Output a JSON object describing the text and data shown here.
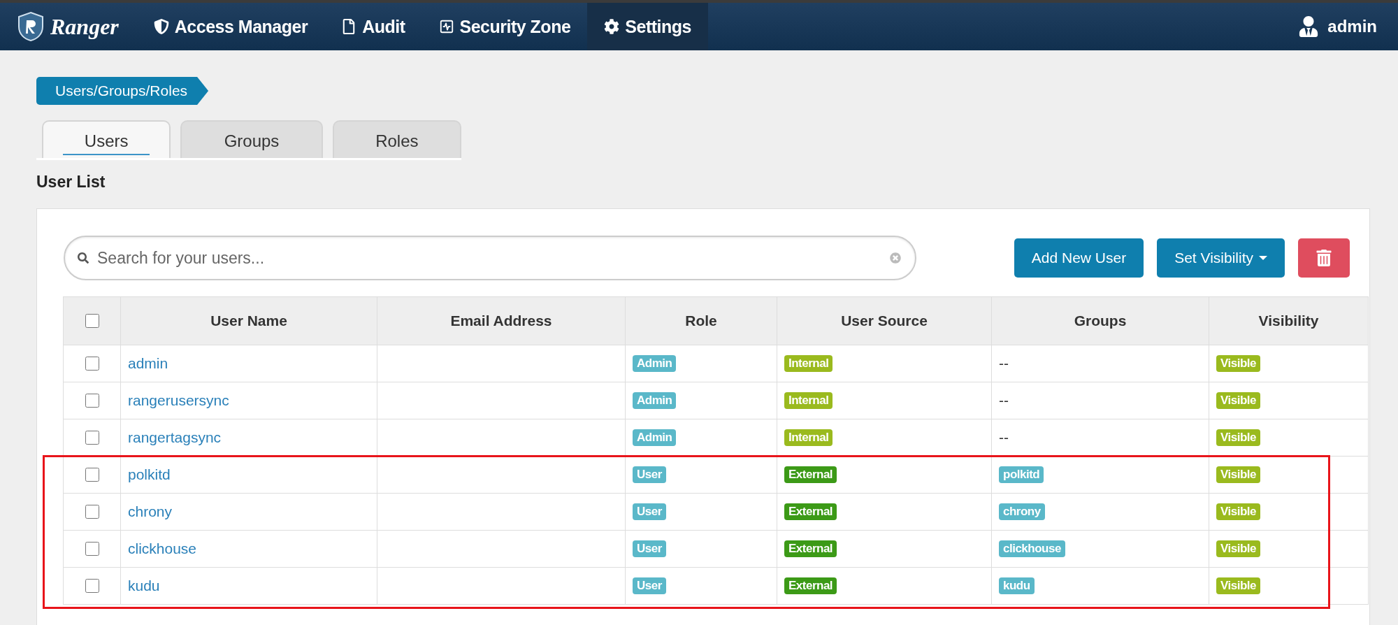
{
  "navbar": {
    "brand": "Ranger",
    "items": [
      {
        "label": "Access Manager",
        "selected": false
      },
      {
        "label": "Audit",
        "selected": false
      },
      {
        "label": "Security Zone",
        "selected": false
      },
      {
        "label": "Settings",
        "selected": true
      }
    ],
    "user": "admin"
  },
  "breadcrumb": "Users/Groups/Roles",
  "tabs": [
    {
      "label": "Users",
      "selected": true
    },
    {
      "label": "Groups",
      "selected": false
    },
    {
      "label": "Roles",
      "selected": false
    }
  ],
  "section_title": "User List",
  "search": {
    "placeholder": "Search for your users..."
  },
  "buttons": [
    {
      "kind": "primary",
      "label": "Add New User"
    },
    {
      "kind": "dropdown",
      "label": "Set Visibility"
    },
    {
      "kind": "delete"
    }
  ],
  "table": {
    "header_checked": false,
    "columns": [
      "User Name",
      "Email Address",
      "Role",
      "User Source",
      "Groups",
      "Visibility"
    ],
    "rows": [
      {
        "name": "admin",
        "role": "Admin",
        "source": {
          "kind": "internal",
          "text": "Internal"
        },
        "groups": {
          "kind": "none",
          "text": "--"
        },
        "visibility": "Visible",
        "checked": false,
        "highlighted": false
      },
      {
        "name": "rangerusersync",
        "role": "Admin",
        "source": {
          "kind": "internal",
          "text": "Internal"
        },
        "groups": {
          "kind": "none",
          "text": "--"
        },
        "visibility": "Visible",
        "checked": false,
        "highlighted": false
      },
      {
        "name": "rangertagsync",
        "role": "Admin",
        "source": {
          "kind": "internal",
          "text": "Internal"
        },
        "groups": {
          "kind": "none",
          "text": "--"
        },
        "visibility": "Visible",
        "checked": false,
        "highlighted": false
      },
      {
        "name": "polkitd",
        "role": "User",
        "source": {
          "kind": "external",
          "text": "External"
        },
        "groups": {
          "kind": "badge",
          "text": "polkitd"
        },
        "visibility": "Visible",
        "checked": false,
        "highlighted": true
      },
      {
        "name": "chrony",
        "role": "User",
        "source": {
          "kind": "external",
          "text": "External"
        },
        "groups": {
          "kind": "badge",
          "text": "chrony"
        },
        "visibility": "Visible",
        "checked": false,
        "highlighted": true
      },
      {
        "name": "clickhouse",
        "role": "User",
        "source": {
          "kind": "external",
          "text": "External"
        },
        "groups": {
          "kind": "badge",
          "text": "clickhouse"
        },
        "visibility": "Visible",
        "checked": false,
        "highlighted": true
      },
      {
        "name": "kudu",
        "role": "User",
        "source": {
          "kind": "external",
          "text": "External"
        },
        "groups": {
          "kind": "badge",
          "text": "kudu"
        },
        "visibility": "Visible",
        "checked": false,
        "highlighted": true
      }
    ]
  }
}
